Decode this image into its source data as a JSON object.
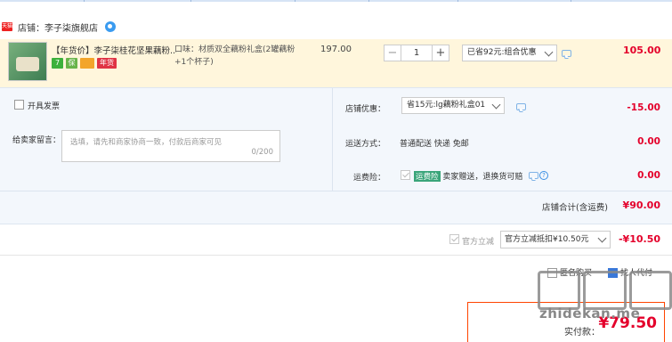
{
  "store": {
    "logo_text": "天猫",
    "label": "店铺：李子柒旗舰店"
  },
  "item": {
    "title": "【年货价】李子柒桂花坚果藕粉...",
    "badges": [
      "7",
      "保",
      "",
      "年货"
    ],
    "spec": "口味：材质双全藕粉礼盒(2罐藕粉+1个杯子)",
    "price": "197.00",
    "quantity": "1",
    "minus": "−",
    "plus": "+",
    "promo": "已省92元:组合优惠",
    "total": "105.00"
  },
  "options": {
    "invoice_label": "开具发票",
    "memo_label": "给卖家留言：",
    "memo_placeholder": "选填，请先和商家协商一致，付款后商家可见",
    "memo_count": "0/200",
    "coupon_label": "店铺优惠：",
    "coupon_value": "省15元:lg藕粉礼盒01",
    "coupon_amount": "-15.00",
    "shipping_label": "运送方式：",
    "shipping_value": "普通配送 快递 免邮",
    "shipping_amount": "0.00",
    "freight_label": "运费险：",
    "freight_tag": "运费险",
    "freight_value": "卖家赠送，退换货可赔",
    "freight_amount": "0.00",
    "help": "?",
    "store_total_label": "店铺合计(含运费)",
    "store_total": "¥90.00"
  },
  "deduct": {
    "label": "官方立减",
    "select": "官方立减抵扣¥10.50元",
    "amount": "-¥10.50"
  },
  "bottom": {
    "anon_label": "匿名购买",
    "other_label": "找人代付",
    "pay_label": "实付款：",
    "pay_amount": "¥79.50",
    "watermark": "zhidekan.me"
  },
  "colors": {
    "price_red": "#e4002b",
    "item_bg": "#fff6dc",
    "option_bg": "#f3f7fc",
    "pay_border": "#ff4400"
  }
}
